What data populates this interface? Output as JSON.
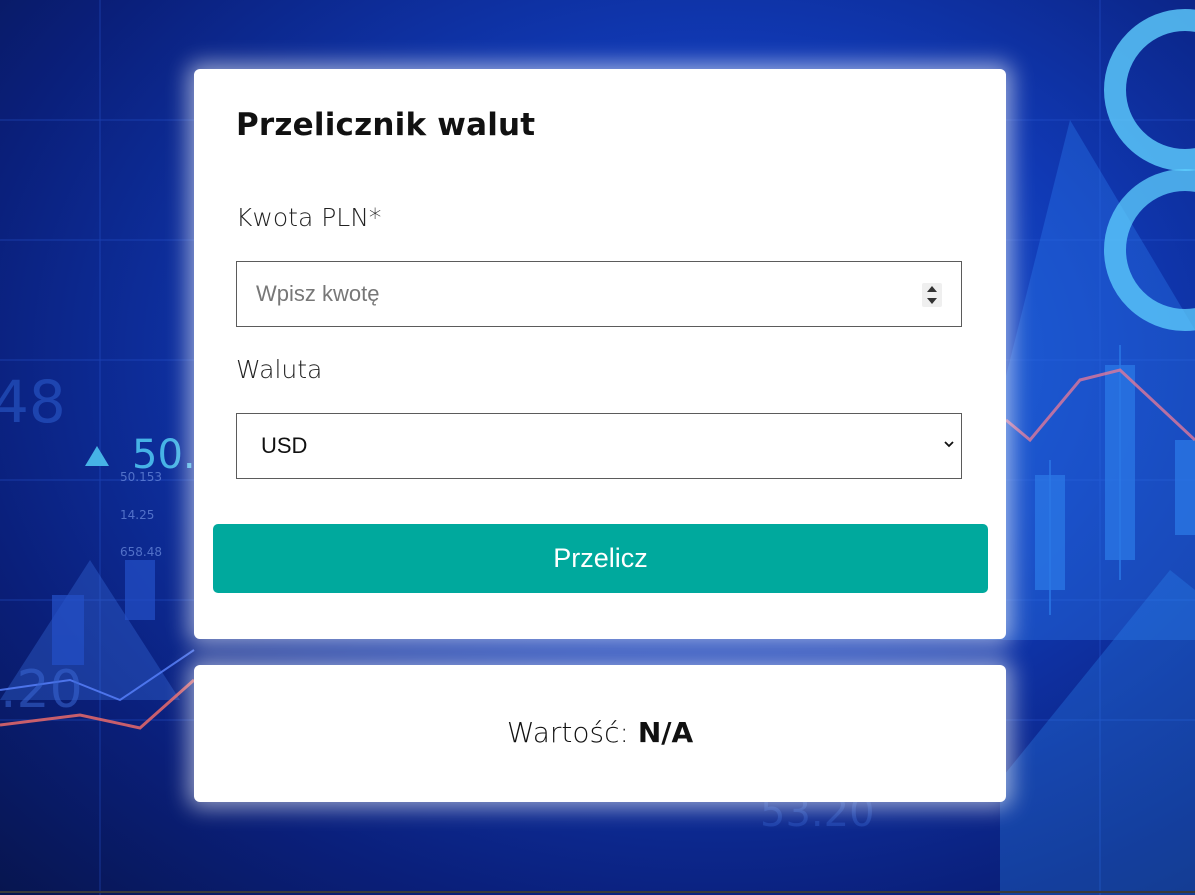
{
  "converter": {
    "title": "Przelicznik walut",
    "amount_label": "Kwota PLN*",
    "amount_placeholder": "Wpisz kwotę",
    "amount_value": "",
    "currency_label": "Waluta",
    "currency_selected": "USD",
    "convert_button_label": "Przelicz"
  },
  "result": {
    "label": "Wartość:",
    "value": "N/A"
  },
  "background_text": {
    "big_number": "50.",
    "small_1": "50.153",
    "small_2": "14.25",
    "small_3": "658.48",
    "left_number": "48",
    "left_bottom": ".20",
    "bottom_right": "53.20"
  },
  "colors": {
    "button": "#00a99d",
    "background": "#1039b4"
  },
  "icons": {
    "spinner": "number-spinner-icon",
    "select": "chevron-down-icon",
    "indicator": "triangle-up-icon"
  }
}
